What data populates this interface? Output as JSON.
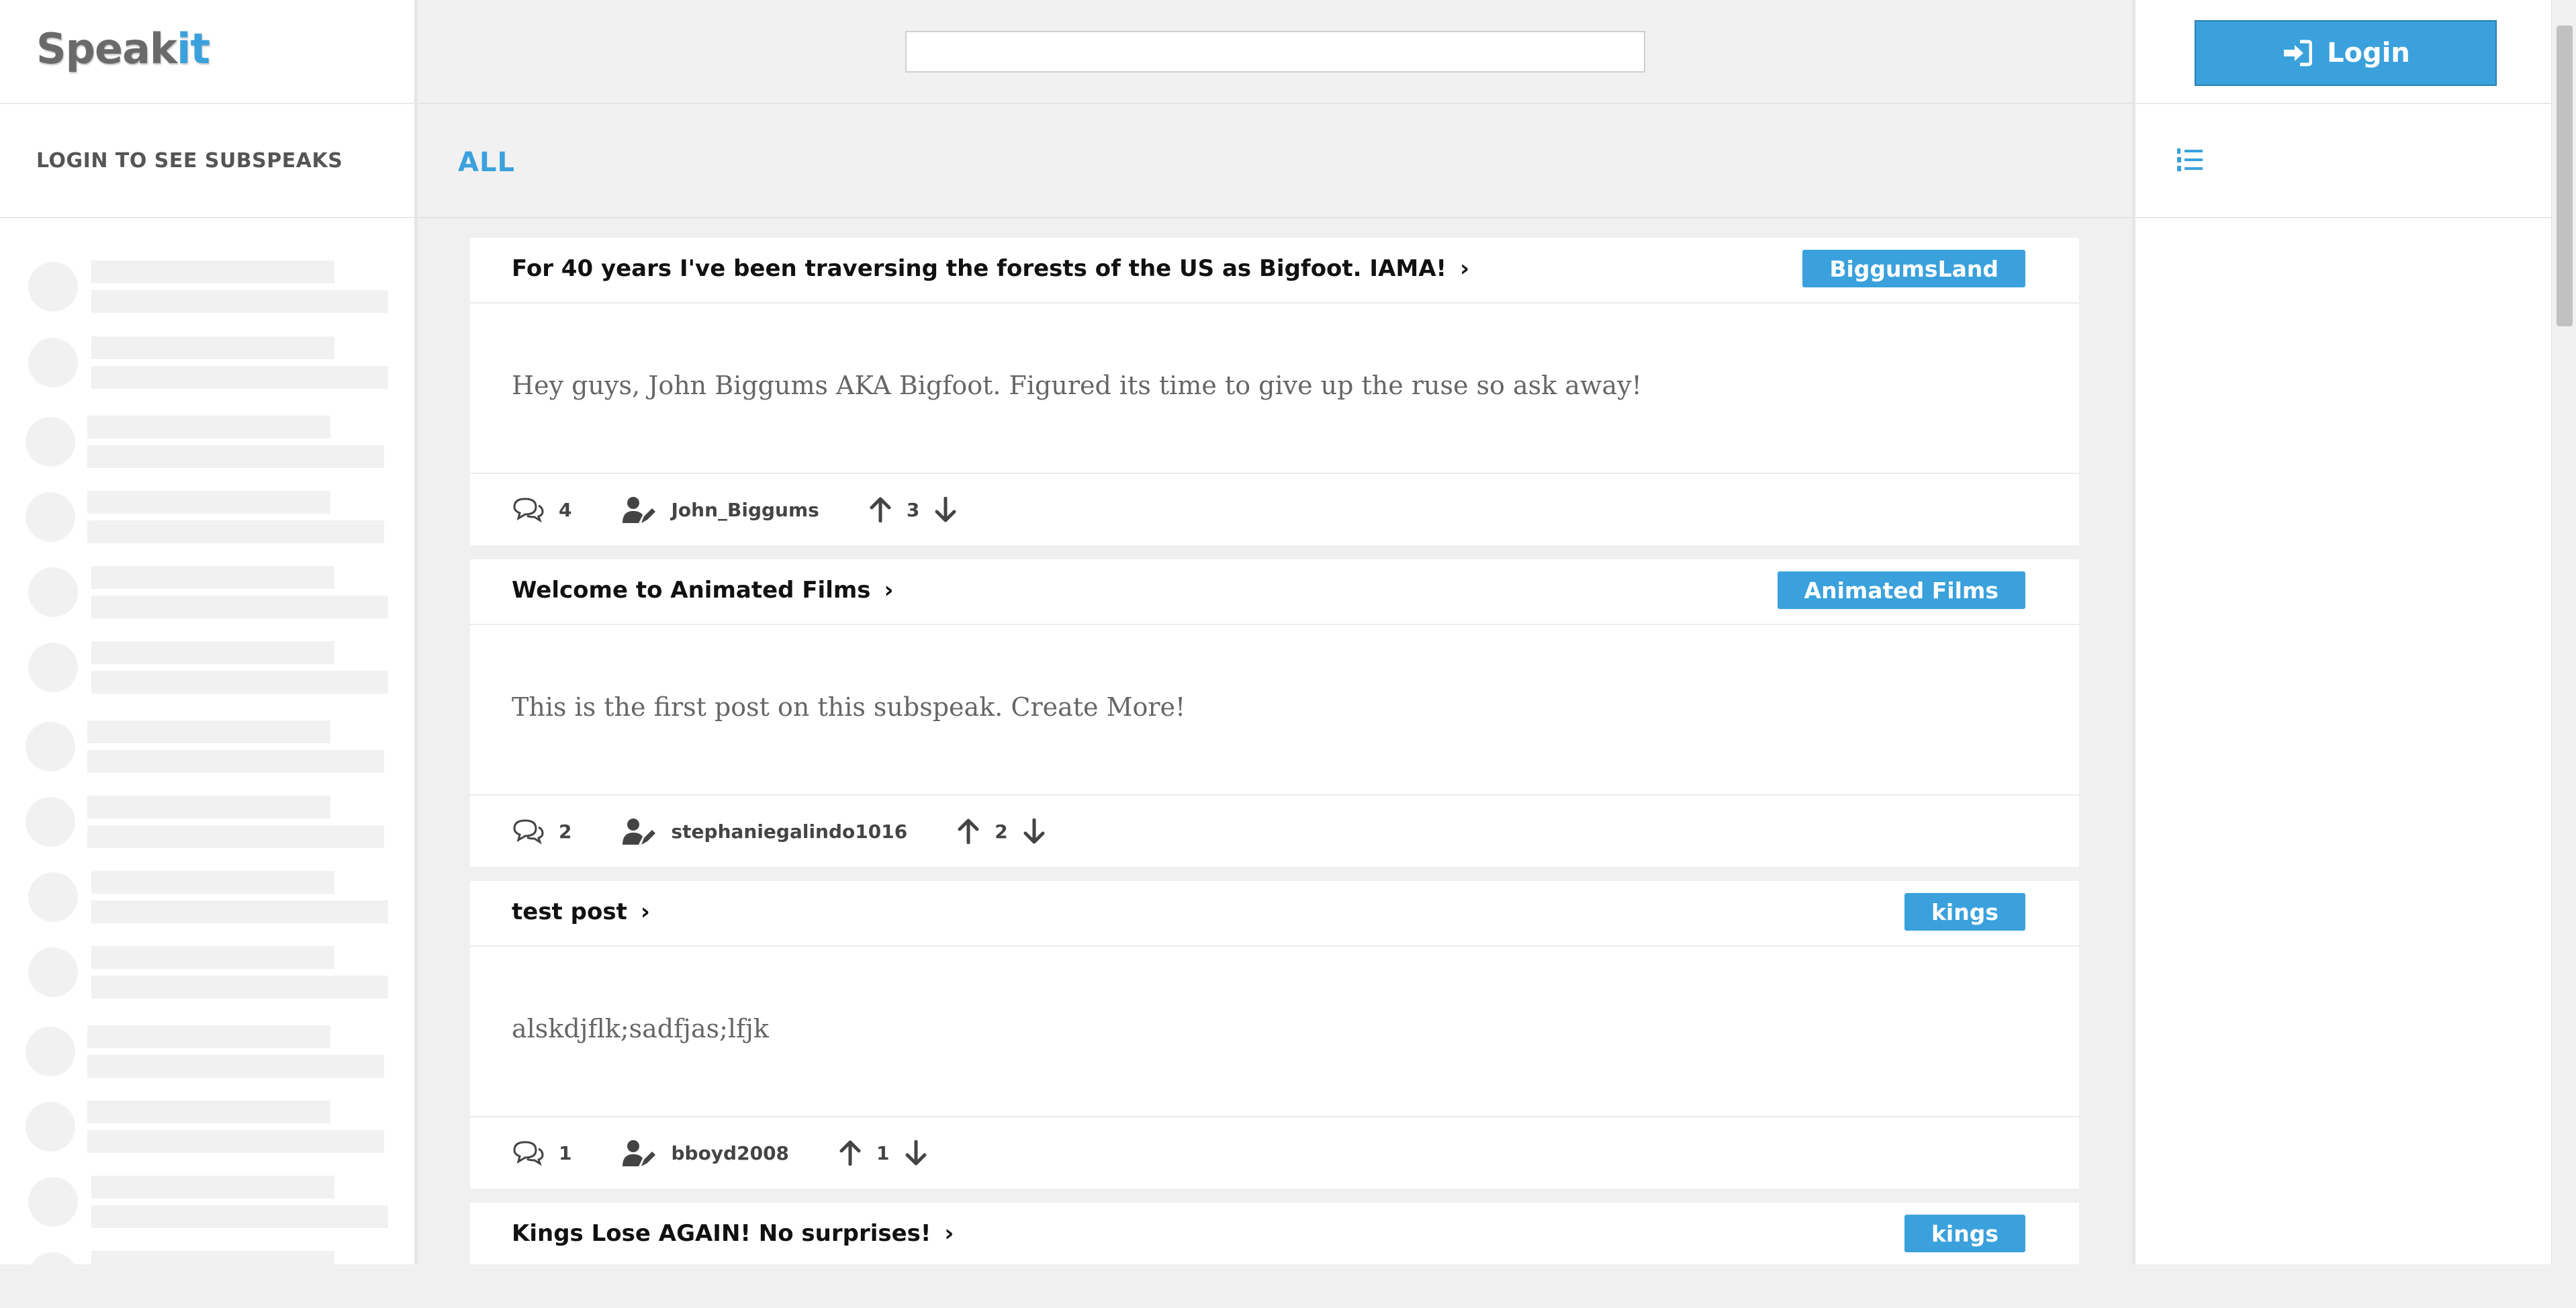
{
  "app": {
    "logo_main": "Speak",
    "logo_accent": "it",
    "subspeaks_header": "LOGIN TO SEE SUBSPEAKS"
  },
  "header": {
    "search_value": "",
    "filter_label": "ALL",
    "login_label": "Login"
  },
  "icons": {
    "login": "login-arrow-icon",
    "list": "numbered-list-icon",
    "comments": "comments-icon",
    "author": "user-edit-icon",
    "upvote": "arrow-up-icon",
    "downvote": "arrow-down-icon",
    "open": "chevron-right-icon"
  },
  "colors": {
    "accent": "#3aa1dc",
    "logo_gray": "#6a6a6a",
    "skeleton": "#f1f1f1"
  },
  "posts": [
    {
      "title": "For 40 years I've been traversing the forests of the US as Bigfoot. IAMA!",
      "chevron": "›",
      "tag": "BiggumsLand",
      "body": "Hey guys, John Biggums AKA Bigfoot. Figured its time to give up the ruse so ask away!",
      "comments": "4",
      "author": "John_Biggums",
      "votes": "3"
    },
    {
      "title": "Welcome to Animated Films",
      "chevron": "›",
      "tag": "Animated Films",
      "body": "This is the first post on this subspeak. Create More!",
      "comments": "2",
      "author": "stephaniegalindo1016",
      "votes": "2"
    },
    {
      "title": "test post",
      "chevron": "›",
      "tag": "kings",
      "body": "alskdjflk;sadfjas;lfjk",
      "comments": "1",
      "author": "bboyd2008",
      "votes": "1"
    },
    {
      "title": "Kings Lose AGAIN! No surprises!",
      "chevron": "›",
      "tag": "kings",
      "body": "",
      "comments": "",
      "author": "",
      "votes": ""
    }
  ]
}
